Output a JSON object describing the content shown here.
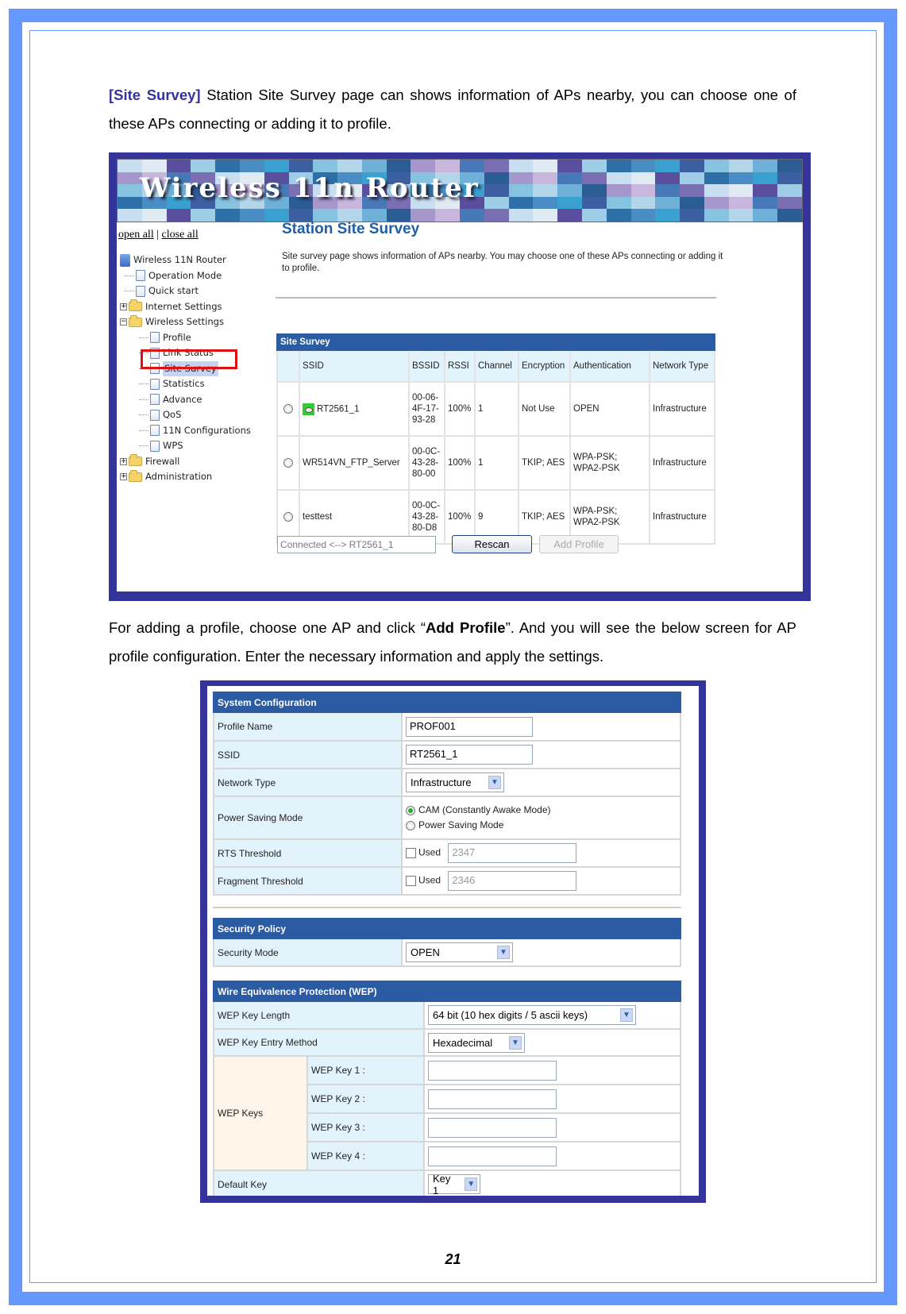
{
  "document": {
    "intro": {
      "keyword": "[Site Survey]",
      "text": " Station Site Survey page can shows information of APs nearby, you can choose one of these APs connecting or adding it to profile."
    },
    "second_paragraph": {
      "before": "For adding a profile, choose one AP and click “",
      "bold": "Add Profile",
      "after": "”. And you will see the below screen for AP profile configuration. Enter the necessary information and apply the settings."
    },
    "page_number": "21"
  },
  "colors": {
    "frame": "#6699ff",
    "screenshot_border": "#333399",
    "keyword": "#333399",
    "table_caption": "#2a5ba3",
    "label_cell": "#e3f3fc",
    "page_title": "#1f5fa8"
  },
  "site_survey_screen": {
    "banner_title": "Wireless 11n Router",
    "open_all": "open all",
    "separator": "|",
    "close_all": "close all",
    "tree": [
      {
        "label": "Wireless 11N Router",
        "icon": "router-icon",
        "level": 0
      },
      {
        "label": "Operation Mode",
        "icon": "page-icon",
        "level": 1
      },
      {
        "label": "Quick start",
        "icon": "page-icon",
        "level": 1
      },
      {
        "label": "Internet Settings",
        "icon": "folder-icon",
        "level": 1,
        "expander": "+"
      },
      {
        "label": "Wireless Settings",
        "icon": "folder-open-icon",
        "level": 1,
        "expander": "−"
      },
      {
        "label": "Profile",
        "icon": "page-icon",
        "level": 2
      },
      {
        "label": "Link Status",
        "icon": "page-icon",
        "level": 2
      },
      {
        "label": "Site Survey",
        "icon": "page-icon",
        "level": 2,
        "selected": true
      },
      {
        "label": "Statistics",
        "icon": "page-icon",
        "level": 2
      },
      {
        "label": "Advance",
        "icon": "page-icon",
        "level": 2
      },
      {
        "label": "QoS",
        "icon": "page-icon",
        "level": 2
      },
      {
        "label": "11N Configurations",
        "icon": "page-icon",
        "level": 2
      },
      {
        "label": "WPS",
        "icon": "page-icon",
        "level": 2
      },
      {
        "label": "Firewall",
        "icon": "folder-icon",
        "level": 1,
        "expander": "+"
      },
      {
        "label": "Administration",
        "icon": "folder-icon",
        "level": 1,
        "expander": "+"
      }
    ],
    "page_title": "Station Site Survey",
    "description": "Site survey page shows information of APs nearby. You may choose one of these APs connecting or adding it to profile.",
    "table": {
      "caption": "Site Survey",
      "columns": [
        "",
        "SSID",
        "BSSID",
        "RSSI",
        "Channel",
        "Encryption",
        "Authentication",
        "Network Type"
      ],
      "rows": [
        {
          "ssid": "RT2561_1",
          "connected_icon": true,
          "bssid": "00-06-4F-17-93-28",
          "rssi": "100%",
          "channel": "1",
          "encryption": "Not Use",
          "authentication": "OPEN",
          "network_type": "Infrastructure"
        },
        {
          "ssid": "WR514VN_FTP_Server",
          "connected_icon": false,
          "bssid": "00-0C-43-28-80-00",
          "rssi": "100%",
          "channel": "1",
          "encryption": "TKIP; AES",
          "authentication": "WPA-PSK; WPA2-PSK",
          "network_type": "Infrastructure"
        },
        {
          "ssid": "testtest",
          "connected_icon": false,
          "bssid": "00-0C-43-28-80-D8",
          "rssi": "100%",
          "channel": "9",
          "encryption": "TKIP; AES",
          "authentication": "WPA-PSK; WPA2-PSK",
          "network_type": "Infrastructure"
        }
      ]
    },
    "connection_status": "Connected <--> RT2561_1",
    "rescan_label": "Rescan",
    "add_profile_label": "Add Profile"
  },
  "profile_screen": {
    "system_configuration": {
      "caption": "System Configuration",
      "profile_name_label": "Profile Name",
      "profile_name_value": "PROF001",
      "ssid_label": "SSID",
      "ssid_value": "RT2561_1",
      "network_type_label": "Network Type",
      "network_type_value": "Infrastructure",
      "power_saving_label": "Power Saving Mode",
      "power_saving_options": [
        "CAM (Constantly Awake Mode)",
        "Power Saving Mode"
      ],
      "power_saving_selected": 0,
      "rts_label": "RTS Threshold",
      "rts_used_label": "Used",
      "rts_used": false,
      "rts_value": "2347",
      "frag_label": "Fragment Threshold",
      "frag_used_label": "Used",
      "frag_used": false,
      "frag_value": "2346"
    },
    "security_policy": {
      "caption": "Security Policy",
      "security_mode_label": "Security Mode",
      "security_mode_value": "OPEN"
    },
    "wep": {
      "caption": "Wire Equivalence Protection (WEP)",
      "key_length_label": "WEP Key Length",
      "key_length_value": "64 bit (10 hex digits / 5 ascii keys)",
      "entry_method_label": "WEP Key Entry Method",
      "entry_method_value": "Hexadecimal",
      "keys_label": "WEP Keys",
      "keys": [
        {
          "label": "WEP Key 1 :",
          "value": ""
        },
        {
          "label": "WEP Key 2 :",
          "value": ""
        },
        {
          "label": "WEP Key 3 :",
          "value": ""
        },
        {
          "label": "WEP Key 4 :",
          "value": ""
        }
      ],
      "default_key_label": "Default Key",
      "default_key_value": "Key 1"
    }
  }
}
